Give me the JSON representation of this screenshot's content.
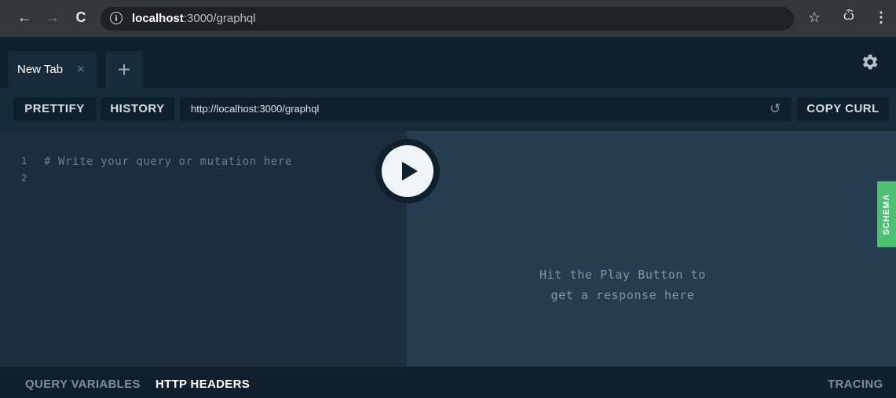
{
  "browser": {
    "back_glyph": "←",
    "forward_glyph": "→",
    "reload_glyph": "C",
    "url_info_glyph": "i",
    "url_host": "localhost",
    "url_path": ":3000/graphql",
    "bookmark_glyph": "☆",
    "incognito_glyph": "ѽ",
    "menu_glyph": "⋮"
  },
  "tabs": [
    {
      "label": "New Tab",
      "close": "×"
    }
  ],
  "tab_add": "+",
  "toolbar": {
    "prettify": "PRETTIFY",
    "history": "HISTORY",
    "endpoint": "http://localhost:3000/graphql",
    "copy_curl": "COPY CURL"
  },
  "editor": {
    "line_numbers": [
      "1",
      "2"
    ],
    "line1": "# Write your query or mutation here"
  },
  "result": {
    "hint_line1": "Hit the Play Button to",
    "hint_line2": "get a response here"
  },
  "schema_tab": "SCHEMA",
  "bottom": {
    "query_variables": "QUERY VARIABLES",
    "http_headers": "HTTP HEADERS",
    "tracing": "TRACING"
  },
  "colors": {
    "accent_schema": "#4fbf73",
    "editor_bg": "#1c2e3e",
    "result_bg": "#263c50",
    "app_bg": "#0f202d"
  }
}
